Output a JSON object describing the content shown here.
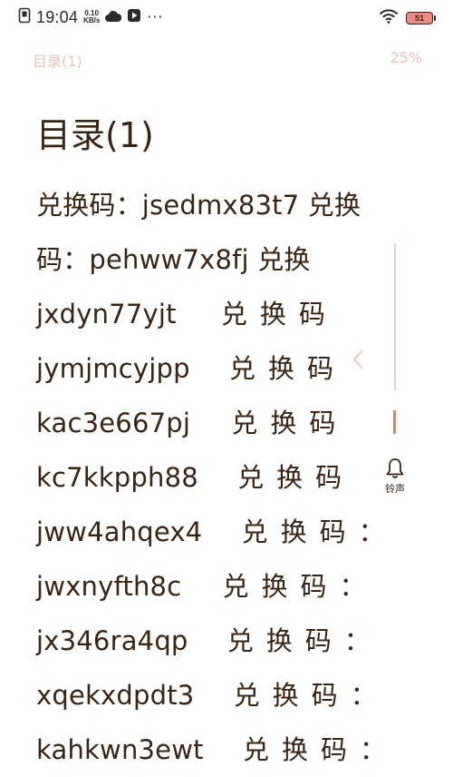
{
  "status_bar": {
    "time": "19:04",
    "net_speed_value": "0.10",
    "net_speed_unit": "KB/s",
    "more": "···",
    "battery": "51"
  },
  "reader_header": {
    "chapter": "目录(1)",
    "progress": "25%"
  },
  "chapter": {
    "title": "目录(1)",
    "lines": [
      {
        "code": "兑换码：jsedmx83t7 兑换",
        "label": ""
      },
      {
        "code": "码：pehww7x8fj 兑换",
        "label": ""
      },
      {
        "code": "jxdyn77yjt",
        "label": "兑换码"
      },
      {
        "code": "jymjmcyjpp",
        "label": "兑换码"
      },
      {
        "code": "kac3e667pj",
        "label": "兑换码"
      },
      {
        "code": "kc7kkpph88",
        "label": "兑换码"
      },
      {
        "code": "jww4ahqex4",
        "label": "兑换码："
      },
      {
        "code": "jwxnyfth8c",
        "label": "兑换码："
      },
      {
        "code": "jx346ra4qp",
        "label": "兑换码："
      },
      {
        "code": "xqekxdpdt3",
        "label": "兑换码："
      },
      {
        "code": "kahkwn3ewt",
        "label": "兑换码："
      }
    ]
  },
  "controls": {
    "ring_label": "铃声",
    "icons": [
      "collapse-arrow-icon",
      "bell-icon",
      "wifi-icon",
      "battery-icon",
      "cloud-icon",
      "play-icon",
      "notification-icon"
    ]
  },
  "colors": {
    "text": "#3b2412",
    "header": "#e8c4b6",
    "accent": "#c98a72"
  }
}
